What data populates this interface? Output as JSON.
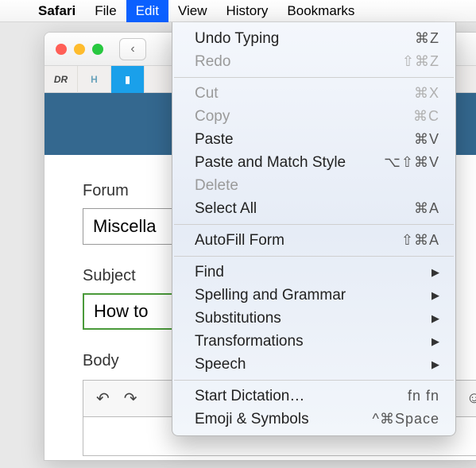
{
  "menubar": {
    "app": "Safari",
    "items": [
      "File",
      "Edit",
      "View",
      "History",
      "Bookmarks"
    ],
    "selected": "Edit"
  },
  "edit_menu": {
    "groups": [
      [
        {
          "label": "Undo Typing",
          "shortcut": "⌘Z",
          "disabled": false
        },
        {
          "label": "Redo",
          "shortcut": "⇧⌘Z",
          "disabled": true
        }
      ],
      [
        {
          "label": "Cut",
          "shortcut": "⌘X",
          "disabled": true
        },
        {
          "label": "Copy",
          "shortcut": "⌘C",
          "disabled": true
        },
        {
          "label": "Paste",
          "shortcut": "⌘V",
          "disabled": false
        },
        {
          "label": "Paste and Match Style",
          "shortcut": "⌥⇧⌘V",
          "disabled": false
        },
        {
          "label": "Delete",
          "shortcut": "",
          "disabled": true
        },
        {
          "label": "Select All",
          "shortcut": "⌘A",
          "disabled": false
        }
      ],
      [
        {
          "label": "AutoFill Form",
          "shortcut": "⇧⌘A",
          "disabled": false
        }
      ],
      [
        {
          "label": "Find",
          "submenu": true
        },
        {
          "label": "Spelling and Grammar",
          "submenu": true
        },
        {
          "label": "Substitutions",
          "submenu": true
        },
        {
          "label": "Transformations",
          "submenu": true
        },
        {
          "label": "Speech",
          "submenu": true
        }
      ],
      [
        {
          "label": "Start Dictation…",
          "shortcut": "fn fn",
          "disabled": false
        },
        {
          "label": "Emoji & Symbols",
          "shortcut": "^⌘Space",
          "disabled": false
        }
      ]
    ]
  },
  "favorites": [
    "DR",
    "H",
    "gift"
  ],
  "form": {
    "forum_label": "Forum",
    "forum_value": "Miscella",
    "subject_label": "Subject",
    "subject_value": "How to",
    "body_label": "Body"
  },
  "icons": {
    "back_arrow": "‹",
    "undo": "↶",
    "redo": "↷",
    "smile": "☺"
  }
}
